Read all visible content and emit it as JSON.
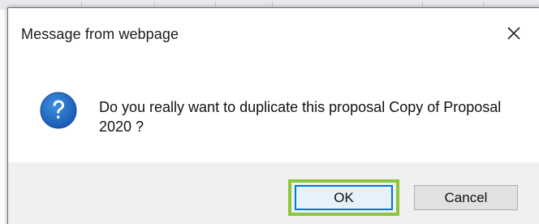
{
  "dialog": {
    "title": "Message from webpage",
    "message": "Do you really want to duplicate this proposal Copy of Proposal 2020 ?",
    "icon": "question-icon",
    "buttons": {
      "ok_label": "OK",
      "cancel_label": "Cancel"
    },
    "highlighted_button": "ok"
  },
  "colors": {
    "icon_blue": "#1b6ac9",
    "highlight_green": "#8cc63e",
    "focus_blue": "#0078d7",
    "button_area_bg": "#f0f0f0"
  }
}
